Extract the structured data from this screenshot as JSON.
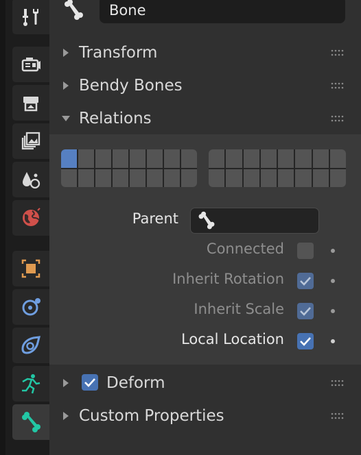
{
  "tabs": [
    {
      "name": "tool",
      "icon": "screwdriver-wrench-icon"
    },
    {
      "name": "render",
      "icon": "render-camera-icon"
    },
    {
      "name": "output",
      "icon": "printer-icon"
    },
    {
      "name": "view-layer",
      "icon": "image-stack-icon"
    },
    {
      "name": "scene",
      "icon": "scene-shapes-icon"
    },
    {
      "name": "world",
      "icon": "world-globe-icon"
    },
    {
      "name": "object",
      "icon": "object-square-icon"
    },
    {
      "name": "physics",
      "icon": "orbit-circle-icon"
    },
    {
      "name": "constraints",
      "icon": "object-constraint-icon"
    },
    {
      "name": "object-data",
      "icon": "armature-running-icon"
    },
    {
      "name": "bone",
      "icon": "bone-icon",
      "active": true
    }
  ],
  "header": {
    "name_value": "Bone",
    "icon": "bone-icon"
  },
  "sections": {
    "transform": "Transform",
    "bendy_bones": "Bendy Bones",
    "relations": "Relations",
    "deform": "Deform",
    "custom_properties": "Custom Properties"
  },
  "relations": {
    "layers_left_active_index": 0,
    "parent_label": "Parent",
    "parent_icon": "bone-icon",
    "connected_label": "Connected",
    "connected_checked": false,
    "inherit_rotation_label": "Inherit Rotation",
    "inherit_rotation_checked": true,
    "inherit_scale_label": "Inherit Scale",
    "inherit_scale_checked": true,
    "local_location_label": "Local Location",
    "local_location_checked": true
  },
  "deform": {
    "checked": true
  },
  "colors": {
    "accent": "#4772b3",
    "layer_active": "#5680c2",
    "panel_bg": "#303030",
    "subpanel_bg": "#3a3a3a",
    "tab_strip_bg": "#1d1d1d"
  }
}
